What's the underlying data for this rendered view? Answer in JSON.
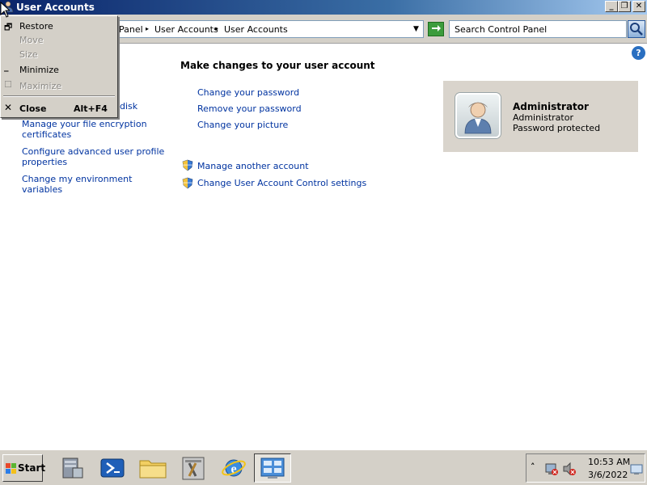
{
  "window": {
    "title": "User Accounts",
    "minimize_glyph": "_",
    "restore_glyph": "❐",
    "close_glyph": "✕"
  },
  "address": {
    "crumbs": [
      "Panel",
      "User Accounts",
      "User Accounts"
    ],
    "search_placeholder": "Search Control Panel"
  },
  "left_pane": {
    "links": [
      "disk",
      "Manage your file encryption certificates",
      "Configure advanced user profile properties",
      "Change my environment variables"
    ]
  },
  "main": {
    "heading": "Make changes to your user account",
    "links": [
      "Change your password",
      "Remove your password",
      "Change your picture"
    ],
    "admin_links": [
      "Manage another account",
      "Change User Account Control settings"
    ]
  },
  "account": {
    "name": "Administrator",
    "role": "Administrator",
    "status": "Password protected"
  },
  "system_menu": {
    "items": [
      {
        "label": "Restore",
        "enabled": true
      },
      {
        "label": "Move",
        "enabled": false
      },
      {
        "label": "Size",
        "enabled": false
      },
      {
        "label": "Minimize",
        "enabled": true
      },
      {
        "label": "Maximize",
        "enabled": false
      }
    ],
    "close": {
      "label": "Close",
      "shortcut": "Alt+F4"
    }
  },
  "taskbar": {
    "start_label": "Start",
    "clock_time": "10:53 AM",
    "clock_date": "3/6/2022",
    "tray_expand": "˄"
  },
  "help_glyph": "?",
  "colors": {
    "link": "#0033a0",
    "title_gradient_start": "#0a246a",
    "chrome": "#d4d0c8",
    "card": "#d9d4cc"
  }
}
